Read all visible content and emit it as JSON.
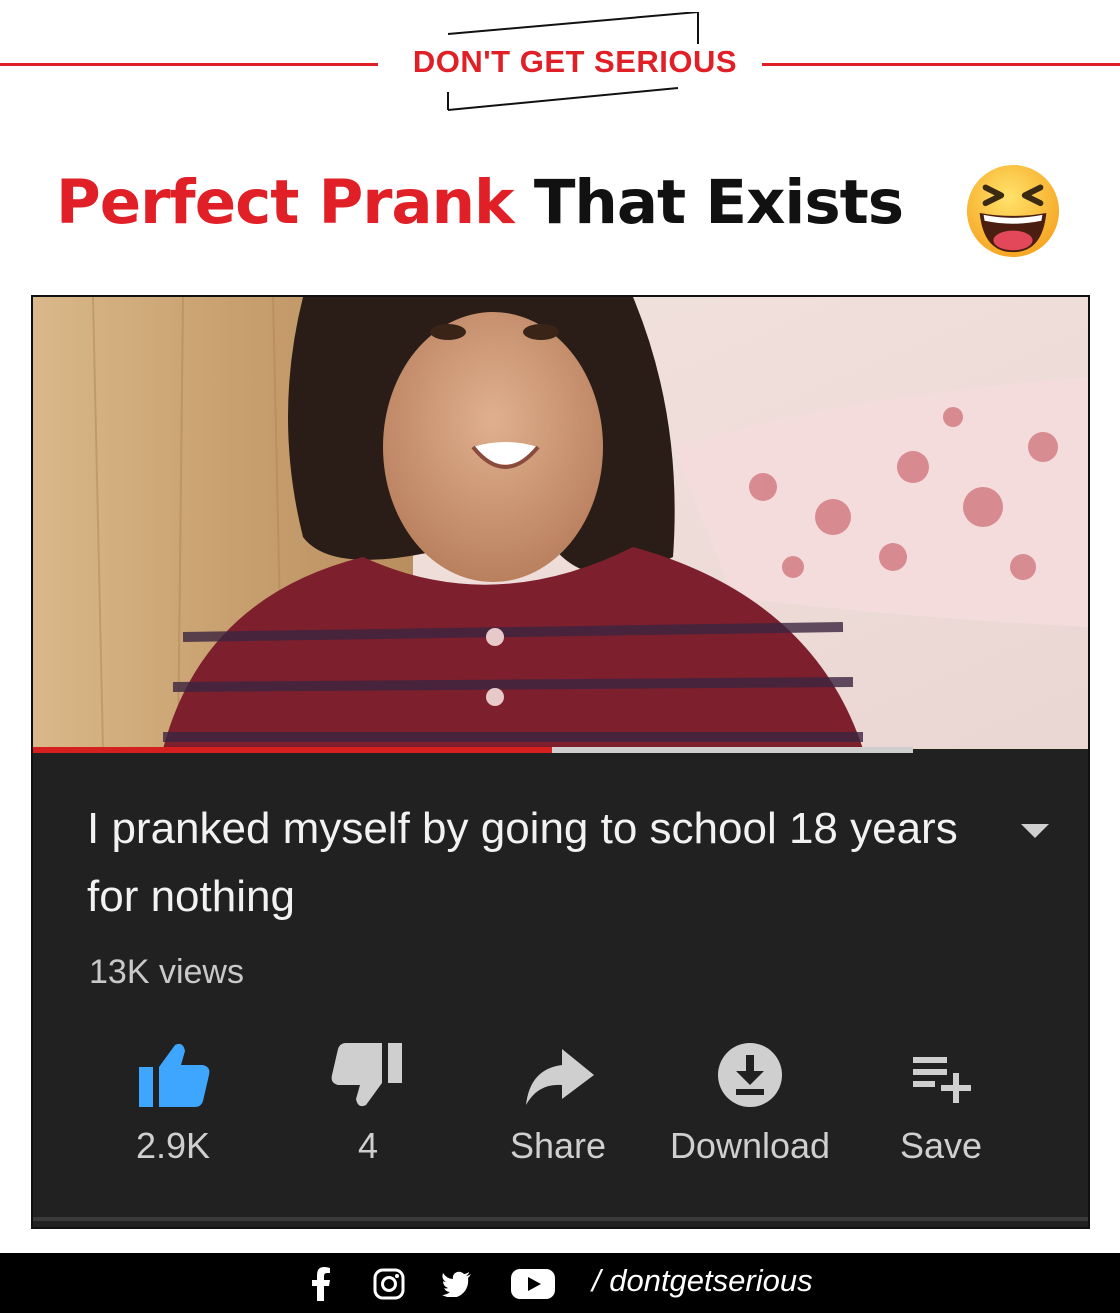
{
  "brand": {
    "name": "DON'T GET SERIOUS",
    "accent": "#e01f26"
  },
  "headline": {
    "part_red": "Perfect Prank",
    "part_black": " That Exists",
    "emoji": "laughing-squint-face"
  },
  "video": {
    "progress": 0.59,
    "title": "I pranked myself by going to school 18 years for nothing",
    "views": "13K views",
    "actions": [
      {
        "icon": "thumbs-up-icon",
        "label": "2.9K",
        "active": true
      },
      {
        "icon": "thumbs-down-icon",
        "label": "4"
      },
      {
        "icon": "share-arrow-icon",
        "label": "Share"
      },
      {
        "icon": "download-icon",
        "label": "Download"
      },
      {
        "icon": "save-playlist-icon",
        "label": "Save"
      }
    ]
  },
  "footer": {
    "icons": [
      "facebook-icon",
      "instagram-icon",
      "twitter-icon",
      "youtube-icon"
    ],
    "handle": "/ dontgetserious"
  }
}
